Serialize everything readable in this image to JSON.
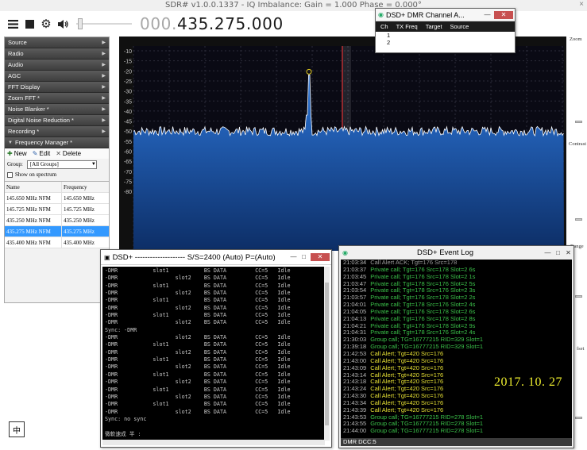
{
  "app": {
    "title": "SDR# v1.0.0.1337 - IQ Imbalance: Gain = 1.000 Phase = 0.000°",
    "frequency_dim": "000.",
    "frequency": "435.275.000"
  },
  "toolbar": {
    "menu_icon": "hamburger-icon",
    "stop_icon": "stop-icon",
    "settings_icon": "gear-icon",
    "volume_icon": "speaker-icon"
  },
  "sidebar": {
    "sections": [
      {
        "label": "Source",
        "state": "collapsed"
      },
      {
        "label": "Radio",
        "state": "collapsed"
      },
      {
        "label": "Audio",
        "state": "collapsed"
      },
      {
        "label": "AGC",
        "state": "collapsed"
      },
      {
        "label": "FFT Display",
        "state": "collapsed"
      },
      {
        "label": "Zoom FFT *",
        "state": "collapsed"
      },
      {
        "label": "Noise Blanker *",
        "state": "collapsed"
      },
      {
        "label": "Digital Noise Reduction *",
        "state": "collapsed"
      },
      {
        "label": "Recording *",
        "state": "collapsed"
      },
      {
        "label": "Frequency Manager *",
        "state": "expanded"
      }
    ],
    "fm": {
      "new_label": "New",
      "edit_label": "Edit",
      "delete_label": "Delete",
      "group_label": "Group:",
      "group_value": "[All Groups]",
      "show_on_spectrum": "Show on spectrum",
      "columns": [
        "Name",
        "Frequency"
      ],
      "rows": [
        {
          "name": "145.650 MHz NFM",
          "freq": "145.650 MHz"
        },
        {
          "name": "145.725 MHz NFM",
          "freq": "145.725 MHz"
        },
        {
          "name": "435.250 MHz NFM",
          "freq": "435.250 MHz"
        },
        {
          "name": "435.275 MHz NFM",
          "freq": "435.275 MHz",
          "selected": true
        },
        {
          "name": "435.400 MHz NFM",
          "freq": "435.400 MHz"
        }
      ]
    }
  },
  "ime": {
    "label": "中"
  },
  "side": {
    "zoom": "Zoom",
    "contrast": "Contrast",
    "range": "Range",
    "offset": "fset"
  },
  "spectrum": {
    "y_ticks": [
      "-10",
      "-15",
      "-20",
      "-25",
      "-30",
      "-35",
      "-40",
      "-45",
      "-50",
      "-55",
      "-60",
      "-65",
      "-70",
      "-75",
      "-80"
    ],
    "ylim": [
      -80,
      -10
    ],
    "noise_floor_db": -50,
    "peak_db": -22,
    "peak_label": "peak marker",
    "colors": {
      "fill": "#1f5eb8",
      "line": "#ffffff",
      "tuned": "#ff3030",
      "marker": "#e8d020"
    }
  },
  "channel_window": {
    "title": "DSD+ DMR Channel A...",
    "columns": [
      "Ch",
      "TX Freq",
      "Target",
      "Source"
    ],
    "rows": [
      "1",
      "2"
    ]
  },
  "dsd_window": {
    "title": "DSD+ --------------------  S/S=2400 (Auto) P=(Auto)",
    "lines": [
      "-DMR           slot1           BS DATA         CC=5   Idle",
      "-DMR                  slot2    BS DATA         CC=5   Idle",
      "-DMR           slot1           BS DATA         CC=5   Idle",
      "-DMR                  slot2    BS DATA         CC=5   Idle",
      "-DMR           slot1           BS DATA         CC=5   Idle",
      "-DMR                  slot2    BS DATA         CC=5   Idle",
      "-DMR           slot1           BS DATA         CC=5   Idle",
      "-DMR                  slot2    BS DATA         CC=5   Idle",
      "Sync: -DMR",
      "-DMR                  slot2    BS DATA         CC=5   Idle",
      "-DMR           slot1           BS DATA         CC=5   Idle",
      "-DMR                  slot2    BS DATA         CC=5   Idle",
      "-DMR           slot1           BS DATA         CC=5   Idle",
      "-DMR                  slot2    BS DATA         CC=5   Idle",
      "-DMR           slot1           BS DATA         CC=5   Idle",
      "-DMR                  slot2    BS DATA         CC=5   Idle",
      "-DMR           slot1           BS DATA         CC=5   Idle",
      "-DMR                  slot2    BS DATA         CC=5   Idle",
      "-DMR           slot1           BS DATA         CC=5   Idle",
      "-DMR                  slot2    BS DATA         CC=5   Idle",
      "Sync: no sync",
      "",
      "微軟速成 半 :"
    ]
  },
  "event_log": {
    "title": "DSD+ Event Log",
    "date_overlay": "2017. 10. 27",
    "status": "DMR  DCC:5",
    "entries": [
      {
        "t": "21:03:34",
        "m": "Call Alert ACK; Tgt=176 Src=178",
        "c": "gray"
      },
      {
        "t": "21:03:37",
        "m": "Private call; Tgt=176 Src=178  Slot=2  6s",
        "c": "green"
      },
      {
        "t": "21:03:45",
        "m": "Private call; Tgt=176 Src=178  Slot=2  1s",
        "c": "green"
      },
      {
        "t": "21:03:47",
        "m": "Private call; Tgt=178 Src=176  Slot=2  5s",
        "c": "green"
      },
      {
        "t": "21:03:54",
        "m": "Private call; Tgt=178 Src=176  Slot=2  3s",
        "c": "green"
      },
      {
        "t": "21:03:57",
        "m": "Private call; Tgt=176 Src=178  Slot=2  2s",
        "c": "green"
      },
      {
        "t": "21:04:01",
        "m": "Private call; Tgt=178 Src=176  Slot=2  4s",
        "c": "green"
      },
      {
        "t": "21:04:05",
        "m": "Private call; Tgt=176 Src=178  Slot=2  6s",
        "c": "green"
      },
      {
        "t": "21:04:13",
        "m": "Private call; Tgt=176 Src=178  Slot=2  8s",
        "c": "green"
      },
      {
        "t": "21:04:21",
        "m": "Private call; Tgt=176 Src=178  Slot=2  9s",
        "c": "green"
      },
      {
        "t": "21:04:31",
        "m": "Private call; Tgt=178 Src=176  Slot=2  4s",
        "c": "green"
      },
      {
        "t": "21:30:03",
        "m": "Group call; TG=16777215 RID=329  Slot=1",
        "c": "green"
      },
      {
        "t": "21:39:18",
        "m": "Group call; TG=16777215 RID=329  Slot=1",
        "c": "green"
      },
      {
        "t": "21:42:53",
        "m": "Call Alert; Tgt=420 Src=176",
        "c": "yellow"
      },
      {
        "t": "21:43:00",
        "m": "Call Alert; Tgt=420 Src=176",
        "c": "yellow"
      },
      {
        "t": "21:43:09",
        "m": "Call Alert; Tgt=420 Src=176",
        "c": "yellow"
      },
      {
        "t": "21:43:14",
        "m": "Call Alert; Tgt=420 Src=176",
        "c": "yellow"
      },
      {
        "t": "21:43:18",
        "m": "Call Alert; Tgt=420 Src=176",
        "c": "yellow"
      },
      {
        "t": "21:43:24",
        "m": "Call Alert; Tgt=420 Src=176",
        "c": "yellow"
      },
      {
        "t": "21:43:30",
        "m": "Call Alert; Tgt=420 Src=176",
        "c": "yellow"
      },
      {
        "t": "21:43:34",
        "m": "Call Alert; Tgt=420 Src=176",
        "c": "yellow"
      },
      {
        "t": "21:43:39",
        "m": "Call Alert; Tgt=420 Src=176",
        "c": "yellow"
      },
      {
        "t": "21:43:53",
        "m": "Group call; TG=16777215 RID=278  Slot=1",
        "c": "green"
      },
      {
        "t": "21:43:55",
        "m": "Group call; TG=16777215 RID=278  Slot=1",
        "c": "green"
      },
      {
        "t": "21:44:00",
        "m": "Group call; TG=16777215 RID=278  Slot=1",
        "c": "green"
      }
    ]
  }
}
